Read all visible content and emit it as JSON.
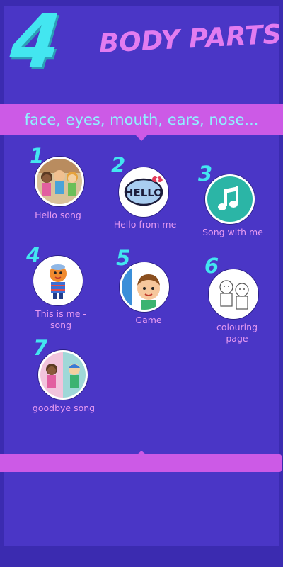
{
  "header": {
    "unit_number": "4",
    "title": "BODY PARTS",
    "subtitle": "face, eyes, mouth, ears, nose..."
  },
  "items": [
    {
      "number": "1",
      "label": "Hello song",
      "icon": "children-waving-thumbnail"
    },
    {
      "number": "2",
      "label": "Hello from me",
      "icon": "hello-bubble-icon"
    },
    {
      "number": "3",
      "label": "Song with me",
      "icon": "music-note-icon"
    },
    {
      "number": "4",
      "label": "This is me  -\nsong",
      "icon": "character-thumbnail"
    },
    {
      "number": "5",
      "label": "Game",
      "icon": "boy-face-thumbnail"
    },
    {
      "number": "6",
      "label": "colouring\npage",
      "icon": "coloring-sketch-thumbnail"
    },
    {
      "number": "7",
      "label": "goodbye song",
      "icon": "children-goodbye-thumbnail"
    }
  ],
  "colors": {
    "background": "#3b2bb0",
    "panel": "#4a36c6",
    "accent_cyan": "#43e6f0",
    "accent_pink": "#cc5ae6",
    "label_pink": "#e69af2"
  }
}
